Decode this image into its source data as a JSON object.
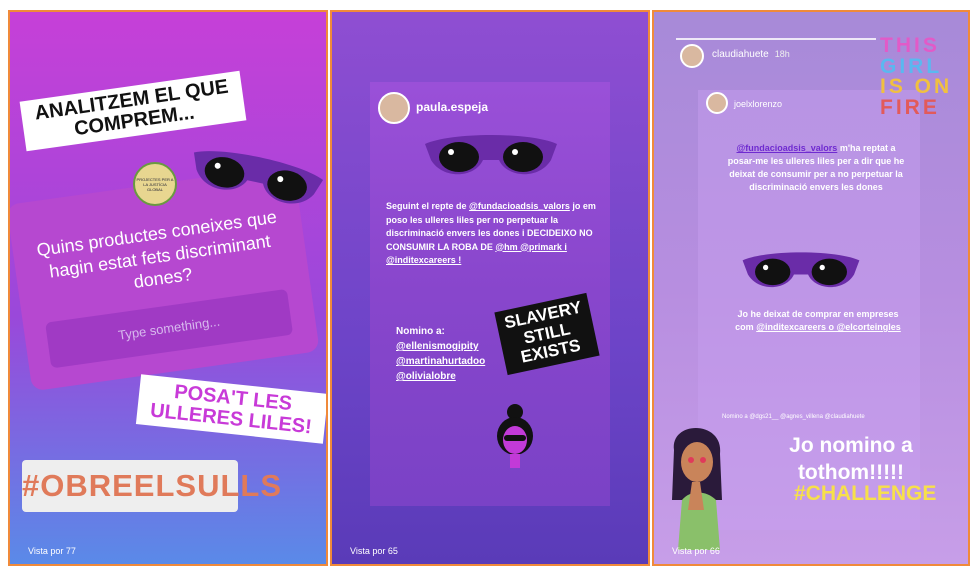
{
  "panels": [
    {
      "views": "Vista por 77",
      "title_sticker": "ANALITZEM EL QUE COMPREM...",
      "logo_text": "PROJECTES PER A LA JUSTÍCIA GLOBAL",
      "question": "Quins productes coneixes que hagin estat fets discriminant dones?",
      "input_placeholder": "Type something...",
      "sticker2": "POSA'T LES ULLERES LILES!",
      "hashtag": "#OBREELSULLS"
    },
    {
      "views": "Vista por 65",
      "username": "paula.espeja",
      "body_1": "Seguint el repte de",
      "body_tag": "@fundacioadsis_valors",
      "body_2": "jo em poso les ulleres liles per no perpetuar la discriminació envers les dones i DECIDEIXO NO CONSUMIR LA ROBA DE",
      "body_tags": "@hm @primark i @inditexcareers !",
      "nomino_title": "Nomino a:",
      "nominees": [
        "@ellenismogipity",
        "@martinahurtadoo",
        "@olivialobre"
      ],
      "slavery": "SLAVERY STILL EXISTS"
    },
    {
      "views": "Vista por 66",
      "username": "claudiahuete",
      "time": "18h",
      "reposted_user": "joelxlorenzo",
      "body_tag": "@fundacioadsis_valors",
      "body_text": "m'ha reptat a posar-me les ulleres liles per a dir que he deixat de consumir per a no perpetuar la discriminació envers les dones",
      "body2": "Jo he deixat de comprar en empreses com",
      "body2_tags": "@inditexcareers o @elcorteingles",
      "tags_line": "Nomino a @dgs21__ @agnes_villena @claudiahuete",
      "big_text": "Jo nomino a tothom!!!!!",
      "challenge": "#CHALLENGE",
      "fire_lines": [
        "THIS",
        "GIRL",
        "IS ON",
        "FIRE"
      ]
    }
  ],
  "colors": {
    "border": "#f08a3a",
    "glasses": "#6a2ca8",
    "tag_purple": "#6f2bd0",
    "challenge_yellow": "#f7e04a"
  },
  "icons": [
    "sunglasses-icon",
    "avatar-icon"
  ]
}
